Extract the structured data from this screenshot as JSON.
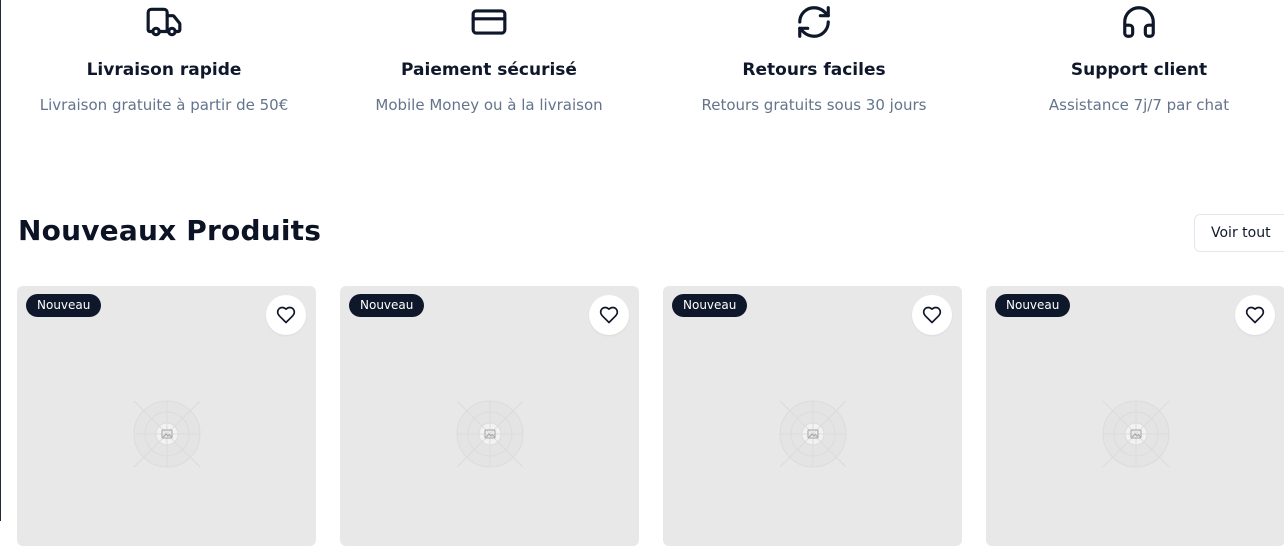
{
  "features": [
    {
      "icon": "truck-icon",
      "title": "Livraison rapide",
      "description": "Livraison gratuite à partir de 50€"
    },
    {
      "icon": "credit-card-icon",
      "title": "Paiement sécurisé",
      "description": "Mobile Money ou à la livraison"
    },
    {
      "icon": "refresh-icon",
      "title": "Retours faciles",
      "description": "Retours gratuits sous 30 jours"
    },
    {
      "icon": "headphones-icon",
      "title": "Support client",
      "description": "Assistance 7j/7 par chat"
    }
  ],
  "new_products": {
    "title": "Nouveaux Produits",
    "see_all_label": "Voir tout",
    "cards": [
      {
        "badge": "Nouveau"
      },
      {
        "badge": "Nouveau"
      },
      {
        "badge": "Nouveau"
      },
      {
        "badge": "Nouveau"
      }
    ]
  },
  "colors": {
    "text_dark": "#0f172a",
    "text_muted": "#64748b",
    "badge_bg": "#0f172a",
    "card_bg": "#e8e8e8"
  }
}
